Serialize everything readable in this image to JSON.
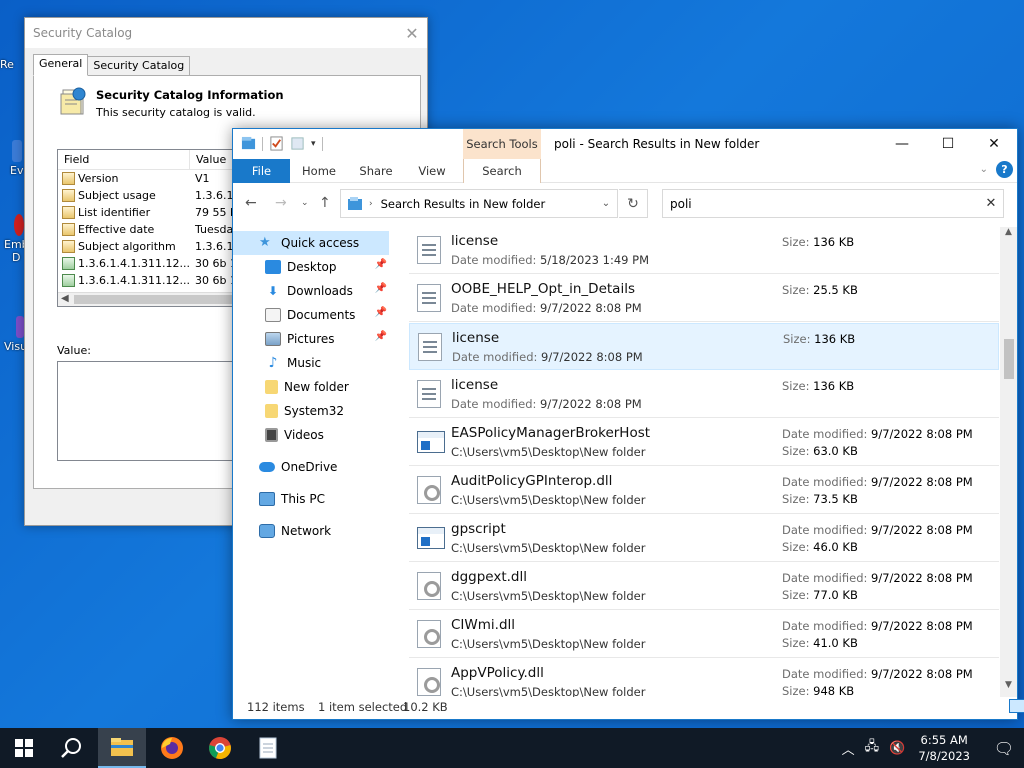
{
  "desktop": {
    "icons": [
      {
        "label": "Re",
        "icon": "recycle-bin-icon"
      },
      {
        "label": "Ev",
        "icon": "app-icon"
      },
      {
        "label": "Emb",
        "icon": "app-icon"
      },
      {
        "label": "D",
        "icon": "app-icon"
      },
      {
        "label": "Visu",
        "icon": "app-icon"
      }
    ]
  },
  "dialog": {
    "title": "Security Catalog",
    "tabs": [
      "General",
      "Security Catalog"
    ],
    "heading": "Security Catalog Information",
    "status": "This security catalog is valid.",
    "list_headers": [
      "Field",
      "Value"
    ],
    "rows": [
      {
        "field": "Version",
        "value": "V1"
      },
      {
        "field": "Subject usage",
        "value": "1.3.6.1."
      },
      {
        "field": "List identifier",
        "value": "79 55 b2"
      },
      {
        "field": "Effective date",
        "value": "Tuesday"
      },
      {
        "field": "Subject algorithm",
        "value": "1.3.6.1."
      },
      {
        "field": "1.3.6.1.4.1.311.12....",
        "value": "30 6b 1e"
      },
      {
        "field": "1.3.6.1.4.1.311.12....",
        "value": "30 6b 1e"
      }
    ],
    "value_label": "Value:"
  },
  "explorer": {
    "title": "poli - Search Results in New folder",
    "context_tab": "Search Tools",
    "ribbon_tabs": [
      "File",
      "Home",
      "Share",
      "View",
      "Search"
    ],
    "address": "Search Results in New folder",
    "search_query": "poli",
    "nav": [
      {
        "label": "Quick access",
        "icon": "star-icon",
        "selected": true
      },
      {
        "label": "Desktop",
        "icon": "desktop-icon",
        "pinned": true
      },
      {
        "label": "Downloads",
        "icon": "download-icon",
        "pinned": true
      },
      {
        "label": "Documents",
        "icon": "documents-icon",
        "pinned": true
      },
      {
        "label": "Pictures",
        "icon": "pictures-icon",
        "pinned": true
      },
      {
        "label": "Music",
        "icon": "music-icon"
      },
      {
        "label": "New folder",
        "icon": "folder-icon"
      },
      {
        "label": "System32",
        "icon": "folder-icon"
      },
      {
        "label": "Videos",
        "icon": "videos-icon"
      },
      {
        "label": "OneDrive",
        "icon": "cloud-icon"
      },
      {
        "label": "This PC",
        "icon": "computer-icon"
      },
      {
        "label": "Network",
        "icon": "network-icon"
      }
    ],
    "date_label": "Date modified:",
    "size_label": "Size:",
    "results": [
      {
        "name": "license",
        "type": "doc",
        "sub_kind": "date",
        "sub": "5/18/2023 1:49 PM",
        "size": "136 KB"
      },
      {
        "name": "OOBE_HELP_Opt_in_Details",
        "type": "doc",
        "sub_kind": "date",
        "sub": "9/7/2022 8:08 PM",
        "size": "25.5 KB"
      },
      {
        "name": "license",
        "type": "doc",
        "sub_kind": "date",
        "sub": "9/7/2022 8:08 PM",
        "size": "136 KB",
        "hover": true
      },
      {
        "name": "license",
        "type": "doc",
        "sub_kind": "date",
        "sub": "9/7/2022 8:08 PM",
        "size": "136 KB"
      },
      {
        "name": "EASPolicyManagerBrokerHost",
        "type": "exe",
        "sub_kind": "path",
        "sub": "C:\\Users\\vm5\\Desktop\\New folder",
        "date": "9/7/2022 8:08 PM",
        "size": "63.0 KB"
      },
      {
        "name": "AuditPolicyGPInterop.dll",
        "type": "dll",
        "sub_kind": "path",
        "sub": "C:\\Users\\vm5\\Desktop\\New folder",
        "date": "9/7/2022 8:08 PM",
        "size": "73.5 KB"
      },
      {
        "name": "gpscript",
        "type": "exe",
        "sub_kind": "path",
        "sub": "C:\\Users\\vm5\\Desktop\\New folder",
        "date": "9/7/2022 8:08 PM",
        "size": "46.0 KB"
      },
      {
        "name": "dggpext.dll",
        "type": "dll",
        "sub_kind": "path",
        "sub": "C:\\Users\\vm5\\Desktop\\New folder",
        "date": "9/7/2022 8:08 PM",
        "size": "77.0 KB"
      },
      {
        "name": "CIWmi.dll",
        "type": "dll",
        "sub_kind": "path",
        "sub": "C:\\Users\\vm5\\Desktop\\New folder",
        "date": "9/7/2022 8:08 PM",
        "size": "41.0 KB"
      },
      {
        "name": "AppVPolicy.dll",
        "type": "dll",
        "sub_kind": "path",
        "sub": "C:\\Users\\vm5\\Desktop\\New folder",
        "date": "9/7/2022 8:08 PM",
        "size": "948 KB"
      }
    ],
    "status": {
      "count": "112 items",
      "selected": "1 item selected",
      "size": "10.2 KB"
    }
  },
  "taskbar": {
    "apps": [
      "start-icon",
      "search-icon",
      "file-explorer-icon",
      "firefox-icon",
      "chrome-icon",
      "notepad-icon"
    ],
    "time": "6:55 AM",
    "date": "7/8/2023"
  },
  "colors": {
    "accent": "#1979ca",
    "search_tools": "#fbe3cc",
    "selected": "#cce8ff",
    "taskbar": "#101a26"
  }
}
